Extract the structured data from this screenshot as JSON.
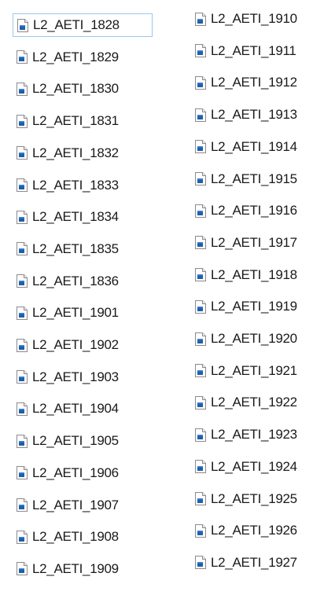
{
  "files": {
    "left_column": [
      {
        "name": "L2_AETI_1828",
        "icon": "document-icon",
        "focused": true
      },
      {
        "name": "L2_AETI_1829",
        "icon": "document-icon"
      },
      {
        "name": "L2_AETI_1830",
        "icon": "document-icon"
      },
      {
        "name": "L2_AETI_1831",
        "icon": "document-icon"
      },
      {
        "name": "L2_AETI_1832",
        "icon": "document-icon"
      },
      {
        "name": "L2_AETI_1833",
        "icon": "document-icon"
      },
      {
        "name": "L2_AETI_1834",
        "icon": "document-icon"
      },
      {
        "name": "L2_AETI_1835",
        "icon": "document-icon"
      },
      {
        "name": "L2_AETI_1836",
        "icon": "document-icon"
      },
      {
        "name": "L2_AETI_1901",
        "icon": "document-icon"
      },
      {
        "name": "L2_AETI_1902",
        "icon": "document-icon"
      },
      {
        "name": "L2_AETI_1903",
        "icon": "document-icon"
      },
      {
        "name": "L2_AETI_1904",
        "icon": "document-icon"
      },
      {
        "name": "L2_AETI_1905",
        "icon": "document-icon"
      },
      {
        "name": "L2_AETI_1906",
        "icon": "document-icon"
      },
      {
        "name": "L2_AETI_1907",
        "icon": "document-icon"
      },
      {
        "name": "L2_AETI_1908",
        "icon": "document-icon"
      },
      {
        "name": "L2_AETI_1909",
        "icon": "document-icon"
      }
    ],
    "right_column": [
      {
        "name": "L2_AETI_1910",
        "icon": "document-icon"
      },
      {
        "name": "L2_AETI_1911",
        "icon": "document-icon"
      },
      {
        "name": "L2_AETI_1912",
        "icon": "document-icon"
      },
      {
        "name": "L2_AETI_1913",
        "icon": "document-icon"
      },
      {
        "name": "L2_AETI_1914",
        "icon": "document-icon"
      },
      {
        "name": "L2_AETI_1915",
        "icon": "document-icon"
      },
      {
        "name": "L2_AETI_1916",
        "icon": "document-icon"
      },
      {
        "name": "L2_AETI_1917",
        "icon": "document-icon"
      },
      {
        "name": "L2_AETI_1918",
        "icon": "document-icon"
      },
      {
        "name": "L2_AETI_1919",
        "icon": "document-icon"
      },
      {
        "name": "L2_AETI_1920",
        "icon": "document-icon"
      },
      {
        "name": "L2_AETI_1921",
        "icon": "document-icon"
      },
      {
        "name": "L2_AETI_1922",
        "icon": "document-icon"
      },
      {
        "name": "L2_AETI_1923",
        "icon": "document-icon"
      },
      {
        "name": "L2_AETI_1924",
        "icon": "document-icon"
      },
      {
        "name": "L2_AETI_1925",
        "icon": "document-icon"
      },
      {
        "name": "L2_AETI_1926",
        "icon": "document-icon"
      },
      {
        "name": "L2_AETI_1927",
        "icon": "document-icon"
      }
    ]
  },
  "colors": {
    "focus_border": "#99c9ef",
    "icon_accent": "#1f5fa8",
    "text": "#1a1a1a"
  }
}
